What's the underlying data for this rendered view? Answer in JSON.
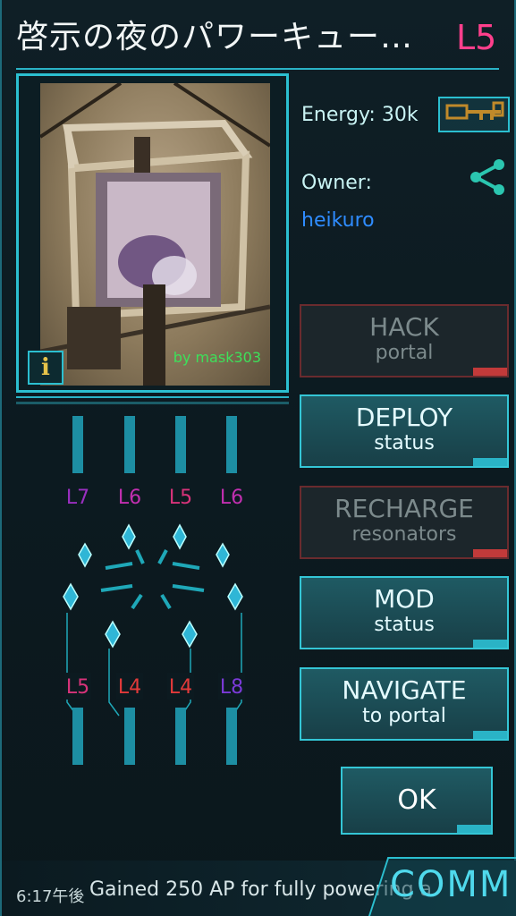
{
  "header": {
    "title": "啓示の夜のパワーキュー…",
    "level": "L5"
  },
  "photo": {
    "credit": "by mask303",
    "info_glyph": "i"
  },
  "portal_info": {
    "energy_label": "Energy:",
    "energy_value": "30k",
    "owner_label": "Owner:",
    "owner_name": "heikuro"
  },
  "actions": [
    {
      "line1": "HACK",
      "line2": "portal",
      "enabled": false
    },
    {
      "line1": "DEPLOY",
      "line2": "status",
      "enabled": true
    },
    {
      "line1": "RECHARGE",
      "line2": "resonators",
      "enabled": false
    },
    {
      "line1": "MOD",
      "line2": "status",
      "enabled": true
    },
    {
      "line1": "NAVIGATE",
      "line2": "to portal",
      "enabled": true
    }
  ],
  "ok_label": "OK",
  "resonators": {
    "top": [
      {
        "label": "L7",
        "color": "#9a2fc0"
      },
      {
        "label": "L6",
        "color": "#c22fb0"
      },
      {
        "label": "L5",
        "color": "#d8337a"
      },
      {
        "label": "L6",
        "color": "#c22fb0"
      }
    ],
    "bottom": [
      {
        "label": "L5",
        "color": "#d8337a"
      },
      {
        "label": "L4",
        "color": "#e23a3a"
      },
      {
        "label": "L4",
        "color": "#e23a3a"
      },
      {
        "label": "L8",
        "color": "#7b3ad8"
      }
    ]
  },
  "status_bar": {
    "time": "6:17午後",
    "message": "Gained 250 AP for fully powering a",
    "comm_label": "COMM"
  },
  "colors": {
    "accent": "#2bbfd0",
    "level": "#ff3f8c",
    "owner": "#2f8cff"
  },
  "icons": {
    "key": "key-icon",
    "share": "share-icon",
    "info": "info-icon"
  }
}
